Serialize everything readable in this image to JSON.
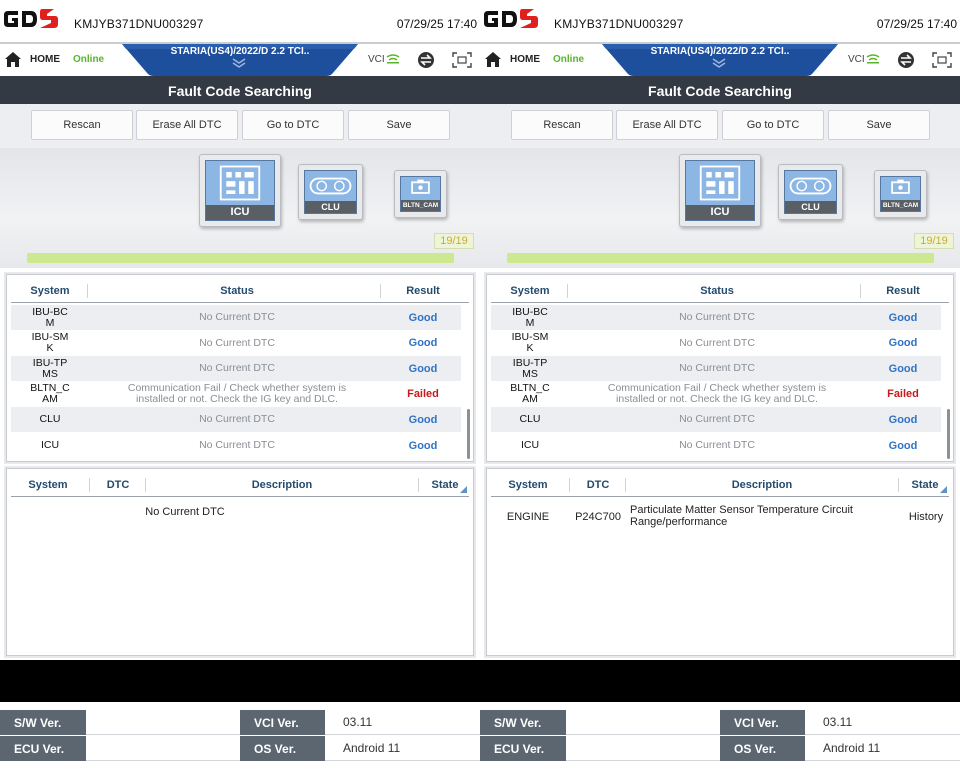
{
  "screens": [
    {
      "vin": "KMJYB371DNU003297",
      "datetime": "07/29/25 17:40",
      "nav": {
        "home": "HOME",
        "online": "Online",
        "vehicle": "STARIA(US4)/2022/D 2.2 TCI..",
        "vci": "VCI"
      },
      "title": "Fault Code Searching",
      "toolbar": {
        "rescan": "Rescan",
        "erase": "Erase All DTC",
        "goto": "Go to DTC",
        "save": "Save"
      },
      "modules": {
        "icu": "ICU",
        "clu": "CLU",
        "cam": "BLTN_CAM"
      },
      "progress": {
        "text": "19/19",
        "fraction": 1.0
      },
      "systems_header": {
        "system": "System",
        "status": "Status",
        "result": "Result"
      },
      "systems": [
        {
          "system": "IBU-BC\nM",
          "status": "No Current DTC",
          "result": "Good"
        },
        {
          "system": "IBU-SM\nK",
          "status": "No Current DTC",
          "result": "Good"
        },
        {
          "system": "IBU-TP\nMS",
          "status": "No Current DTC",
          "result": "Good"
        },
        {
          "system": "BLTN_C\nAM",
          "status": "Communication Fail / Check whether system is\ninstalled or not. Check the IG key and DLC.",
          "result": "Failed"
        },
        {
          "system": "CLU",
          "status": "No Current DTC",
          "result": "Good"
        },
        {
          "system": "ICU",
          "status": "No Current DTC",
          "result": "Good"
        }
      ],
      "dtc_header": {
        "system": "System",
        "dtc": "DTC",
        "description": "Description",
        "state": "State"
      },
      "dtc_empty": "No Current DTC"
    },
    {
      "vin": "KMJYB371DNU003297",
      "datetime": "07/29/25 17:40",
      "nav": {
        "home": "HOME",
        "online": "Online",
        "vehicle": "STARIA(US4)/2022/D 2.2 TCI..",
        "vci": "VCI"
      },
      "title": "Fault Code Searching",
      "toolbar": {
        "rescan": "Rescan",
        "erase": "Erase All DTC",
        "goto": "Go to DTC",
        "save": "Save"
      },
      "modules": {
        "icu": "ICU",
        "clu": "CLU",
        "cam": "BLTN_CAM"
      },
      "progress": {
        "text": "19/19",
        "fraction": 1.0
      },
      "systems_header": {
        "system": "System",
        "status": "Status",
        "result": "Result"
      },
      "systems": [
        {
          "system": "IBU-BC\nM",
          "status": "No Current DTC",
          "result": "Good"
        },
        {
          "system": "IBU-SM\nK",
          "status": "No Current DTC",
          "result": "Good"
        },
        {
          "system": "IBU-TP\nMS",
          "status": "No Current DTC",
          "result": "Good"
        },
        {
          "system": "BLTN_C\nAM",
          "status": "Communication Fail / Check whether system is\ninstalled or not. Check the IG key and DLC.",
          "result": "Failed"
        },
        {
          "system": "CLU",
          "status": "No Current DTC",
          "result": "Good"
        },
        {
          "system": "ICU",
          "status": "No Current DTC",
          "result": "Good"
        }
      ],
      "dtc_header": {
        "system": "System",
        "dtc": "DTC",
        "description": "Description",
        "state": "State"
      },
      "dtc": {
        "system": "ENGINE",
        "code": "P24C700",
        "description": "Particulate Matter Sensor Temperature Circuit\nRange/performance",
        "state": "History"
      }
    }
  ],
  "versions": [
    {
      "sw_label": "S/W Ver.",
      "sw_value": "",
      "vci_label": "VCI Ver.",
      "vci_value": "03.11",
      "ecu_label": "ECU Ver.",
      "ecu_value": "",
      "os_label": "OS Ver.",
      "os_value": "Android 11"
    },
    {
      "sw_label": "S/W Ver.",
      "sw_value": "",
      "vci_label": "VCI Ver.",
      "vci_value": "03.11",
      "ecu_label": "ECU Ver.",
      "ecu_value": "",
      "os_label": "OS Ver.",
      "os_value": "Android 11"
    }
  ],
  "colors": {
    "good": "#2f73c4",
    "failed": "#c41a1a",
    "online": "#5ab52c",
    "title_bg": "#333a43",
    "vehicle_tab": "#1e4f9c",
    "header_text": "#234b6e"
  },
  "icons": [
    "gds-logo",
    "home-icon",
    "vci-signal-icon",
    "swap-icon",
    "capture-icon",
    "chevron-down-icon",
    "module-icu-icon",
    "module-clu-icon",
    "module-cam-icon",
    "sort-corner-icon"
  ]
}
